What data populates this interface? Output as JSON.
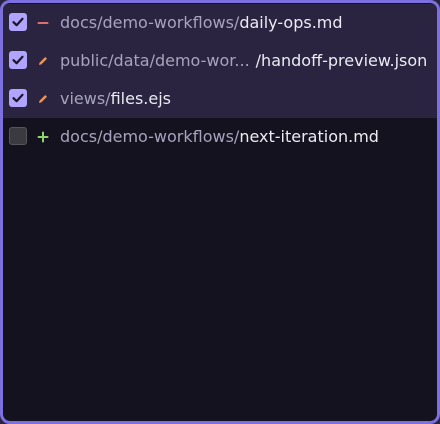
{
  "files": [
    {
      "checked": true,
      "status": "deleted",
      "status_icon": "minus-icon",
      "dir": "docs/demo-workflows/",
      "name": "daily-ops.md"
    },
    {
      "checked": true,
      "status": "modified",
      "status_icon": "pencil-icon",
      "dir": "public/data/demo-wor...",
      "name": "/handoff-preview.json"
    },
    {
      "checked": true,
      "status": "modified",
      "status_icon": "pencil-icon",
      "dir": "views/",
      "name": "files.ejs"
    },
    {
      "checked": false,
      "status": "added",
      "status_icon": "plus-icon",
      "dir": "docs/demo-workflows/",
      "name": "next-iteration.md"
    }
  ],
  "colors": {
    "border_accent": "#7c6fe0",
    "checkbox_checked": "#b1a4ff",
    "deleted": "#e06c6c",
    "modified": "#e8955a",
    "added": "#8fd46a"
  }
}
